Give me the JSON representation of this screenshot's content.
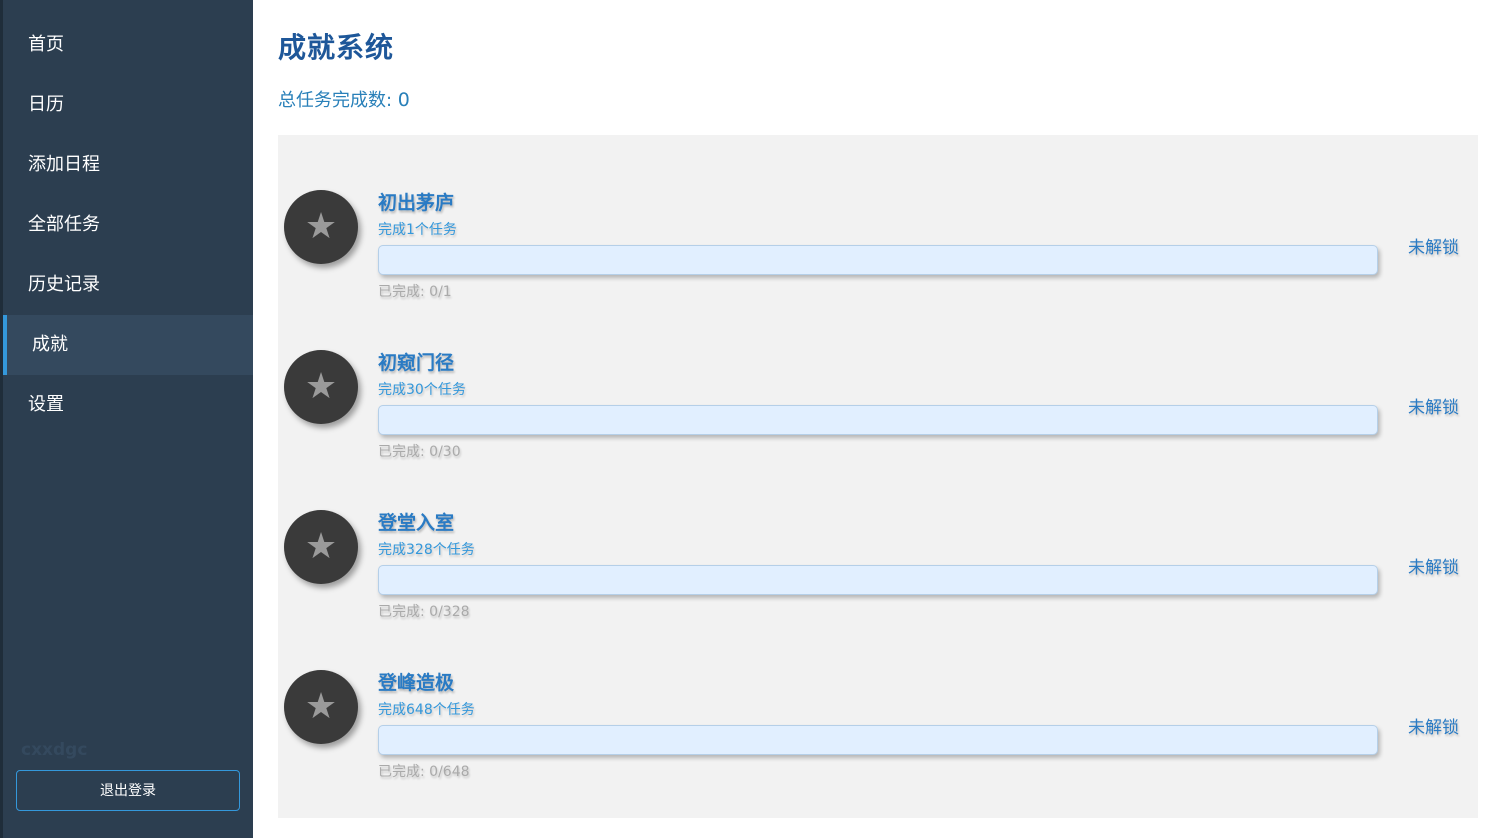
{
  "sidebar": {
    "items": [
      {
        "label": "首页"
      },
      {
        "label": "日历"
      },
      {
        "label": "添加日程"
      },
      {
        "label": "全部任务"
      },
      {
        "label": "历史记录"
      },
      {
        "label": "成就",
        "active": true
      },
      {
        "label": "设置"
      }
    ],
    "username": "cxxdgc",
    "logout_label": "退出登录"
  },
  "main": {
    "title": "成就系统",
    "total_label": "总任务完成数: ",
    "total_value": "0"
  },
  "achievements": [
    {
      "name": "初出茅庐",
      "desc": "完成1个任务",
      "progress": "已完成: 0/1",
      "progress_fraction": 0,
      "status": "未解锁",
      "icon": "star-icon"
    },
    {
      "name": "初窥门径",
      "desc": "完成30个任务",
      "progress": "已完成: 0/30",
      "progress_fraction": 0,
      "status": "未解锁",
      "icon": "star-icon"
    },
    {
      "name": "登堂入室",
      "desc": "完成328个任务",
      "progress": "已完成: 0/328",
      "progress_fraction": 0,
      "status": "未解锁",
      "icon": "star-icon"
    },
    {
      "name": "登峰造极",
      "desc": "完成648个任务",
      "progress": "已完成: 0/648",
      "progress_fraction": 0,
      "status": "未解锁",
      "icon": "star-icon"
    }
  ],
  "colors": {
    "sidebar_bg": "#2c3e50",
    "sidebar_active": "#34495e",
    "accent": "#3498db",
    "title": "#1e5799",
    "panel_bg": "#f2f2f2",
    "bar_bg": "#e1efff",
    "badge_bg": "#3a3a3a"
  }
}
